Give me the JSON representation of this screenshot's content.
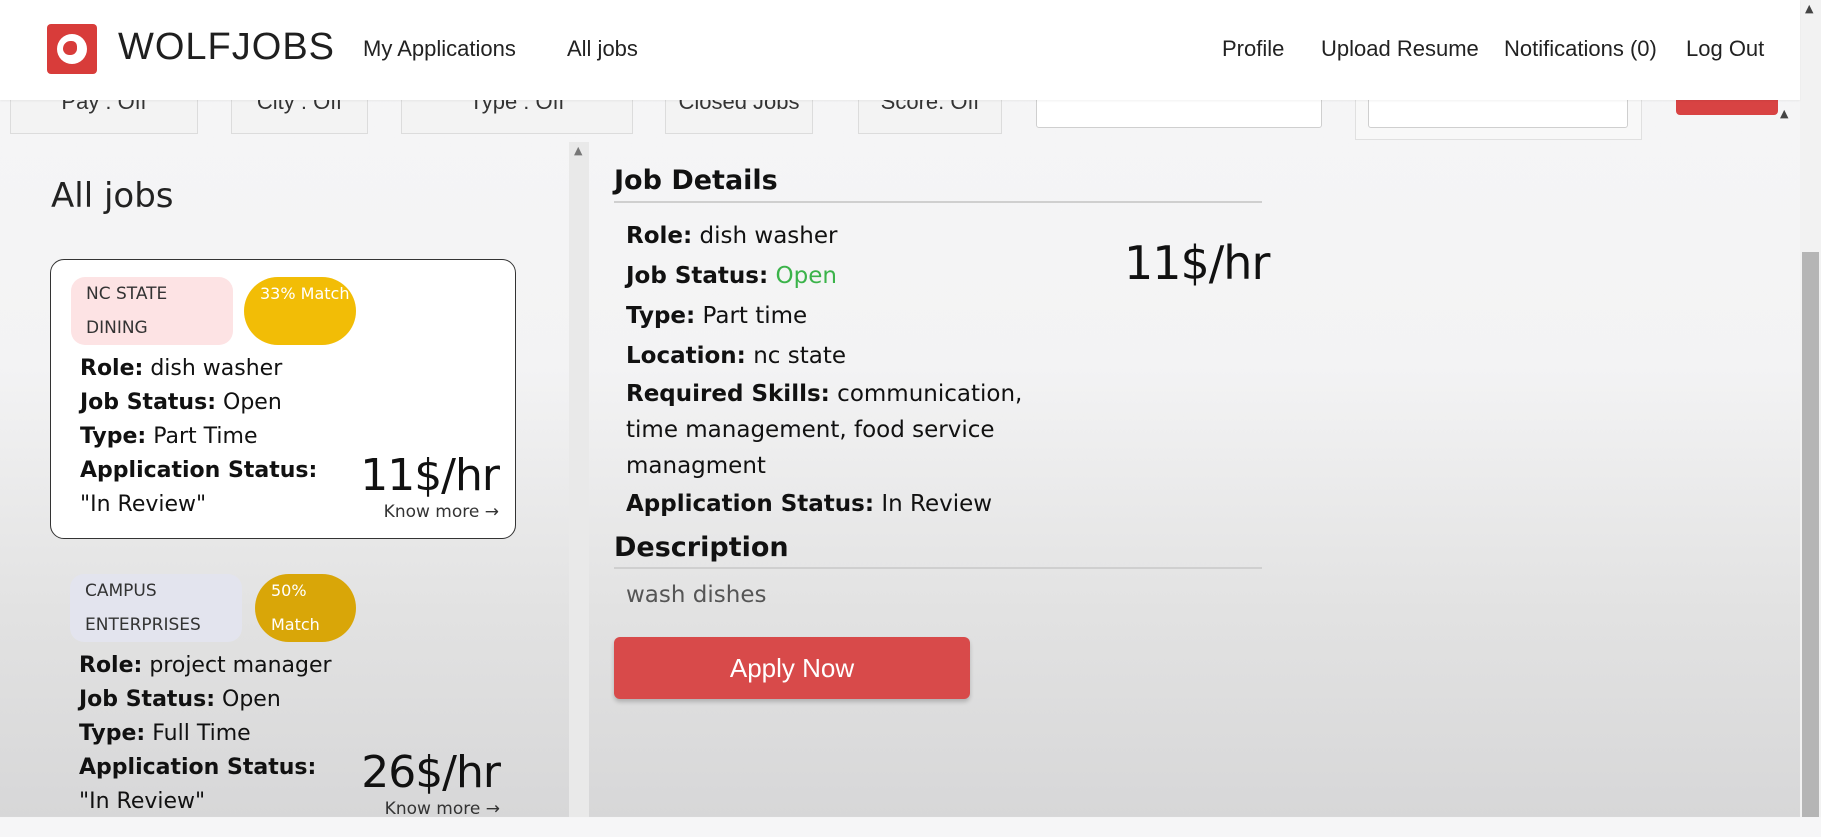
{
  "header": {
    "brand": "WOLFJOBS",
    "links": {
      "my_applications": "My Applications",
      "all_jobs": "All jobs",
      "profile": "Profile",
      "upload_resume": "Upload Resume",
      "notifications": "Notifications (0)",
      "logout": "Log Out"
    }
  },
  "filters": [
    "Pay : Off",
    "City : Off",
    "Type : Off",
    "Closed Jobs",
    "Score: Off"
  ],
  "list": {
    "title": "All jobs",
    "jobs": [
      {
        "company": "NC STATE DINING",
        "match": "33% Match",
        "role_label": "Role:",
        "role": "dish washer",
        "status_label": "Job Status:",
        "status": "Open",
        "type_label": "Type:",
        "type": "Part Time",
        "app_label": "Application Status:",
        "app_status": "\"In Review\"",
        "pay": "11$/hr",
        "more": "Know more →"
      },
      {
        "company": "CAMPUS ENTERPRISES",
        "match": "50% Match",
        "role_label": "Role:",
        "role": "project manager",
        "status_label": "Job Status:",
        "status": "Open",
        "type_label": "Type:",
        "type": "Full Time",
        "app_label": "Application Status:",
        "app_status": "\"In Review\"",
        "pay": "26$/hr",
        "more": "Know more →"
      }
    ]
  },
  "details": {
    "title": "Job Details",
    "role_label": "Role:",
    "role": "dish washer",
    "status_label": "Job Status:",
    "status": "Open",
    "type_label": "Type:",
    "type": "Part time",
    "location_label": "Location:",
    "location": "nc state",
    "skills_label": "Required Skills:",
    "skills": "communication, time management, food service managment",
    "app_label": "Application Status:",
    "app_status": "In Review",
    "pay": "11$/hr",
    "description_title": "Description",
    "description": "wash dishes",
    "apply": "Apply Now"
  },
  "colors": {
    "brand_red": "#d83c3a",
    "match_yellow": "#f2bd06",
    "open_green": "#3bb34a"
  }
}
